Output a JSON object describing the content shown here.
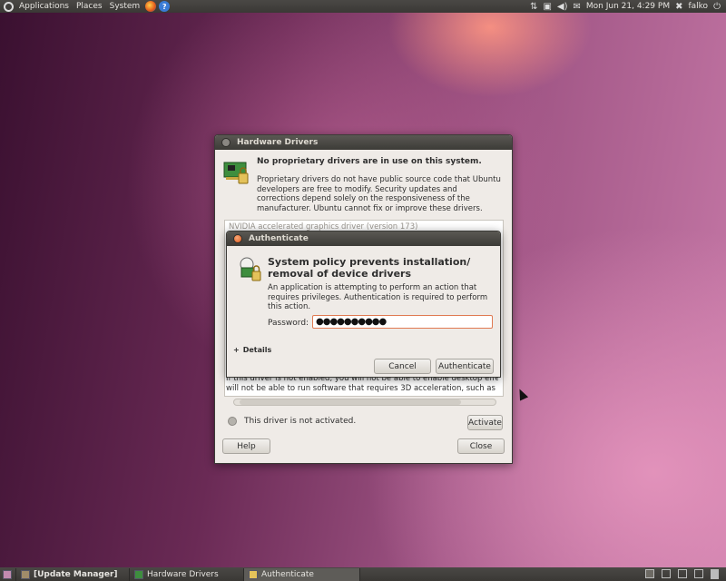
{
  "top_panel": {
    "menus": [
      "Applications",
      "Places",
      "System"
    ],
    "clock": "Mon Jun 21,  4:29 PM",
    "user": "falko"
  },
  "hardware_drivers": {
    "title": "Hardware Drivers",
    "heading": "No proprietary drivers are in use on this system.",
    "body": "Proprietary drivers do not have public source code that Ubuntu developers are free to modify. Security updates and corrections depend solely on the responsiveness of the manufacturer. Ubuntu cannot fix or improve these drivers.",
    "list_item": "NVIDIA accelerated graphics driver (version 173)",
    "description_line1": "If this driver is not enabled, you will not be able to enable desktop effects and",
    "description_line2": "will not be able to run software that requires 3D acceleration, such as some",
    "status": "This driver is not activated.",
    "activate_label": "Activate",
    "help_label": "Help",
    "close_label": "Close"
  },
  "authenticate": {
    "title": "Authenticate",
    "heading": "System policy prevents installation/ removal of device drivers",
    "body": "An application is attempting to perform an action that requires privileges. Authentication is required to perform this action.",
    "password_label": "Password:",
    "password_value": "●●●●●●●●●●",
    "details_label": "Details",
    "details_toggle": "+",
    "cancel_label": "Cancel",
    "authenticate_label": "Authenticate"
  },
  "taskbar": {
    "items": [
      "[Update Manager]",
      "Hardware Drivers",
      "Authenticate"
    ]
  }
}
